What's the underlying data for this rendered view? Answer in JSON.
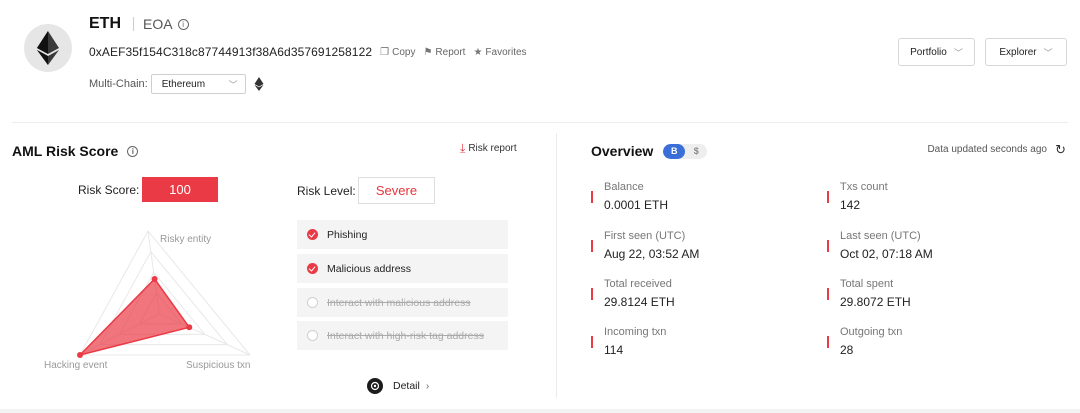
{
  "header": {
    "title": "ETH",
    "account_type": "EOA",
    "address": "0xAEF35f154C318c87744913f38A6d357691258122",
    "actions": {
      "copy": "Copy",
      "report": "Report",
      "favorites": "Favorites"
    },
    "multichain_label": "Multi-Chain:",
    "multichain_value": "Ethereum",
    "portfolio_label": "Portfolio",
    "explorer_label": "Explorer"
  },
  "aml": {
    "title": "AML Risk Score",
    "risk_report_label": "Risk report",
    "score_label": "Risk Score:",
    "score_value": "100",
    "level_label": "Risk Level:",
    "level_value": "Severe",
    "radar": {
      "axes": [
        "Risky entity",
        "Suspicious txn",
        "Hacking event"
      ],
      "values": [
        0.42,
        0.33,
        1.0
      ],
      "fill_color": "#ea3a46"
    },
    "risk_items": [
      {
        "label": "Phishing",
        "active": true
      },
      {
        "label": "Malicious address",
        "active": true
      },
      {
        "label": "Interact with malicious address",
        "active": false
      },
      {
        "label": "Interact with high-risk tag address",
        "active": false
      }
    ],
    "detail_label": "Detail"
  },
  "overview": {
    "title": "Overview",
    "toggle": [
      "B",
      "$"
    ],
    "updated_text": "Data updated seconds ago",
    "stats": [
      {
        "label": "Balance",
        "value": "0.0001 ETH"
      },
      {
        "label": "Txs count",
        "value": "142"
      },
      {
        "label": "First seen (UTC)",
        "value": "Aug 22, 03:52 AM"
      },
      {
        "label": "Last seen (UTC)",
        "value": "Oct 02, 07:18 AM"
      },
      {
        "label": "Total received",
        "value": "29.8124 ETH"
      },
      {
        "label": "Total spent",
        "value": "29.8072 ETH"
      },
      {
        "label": "Incoming txn",
        "value": "114"
      },
      {
        "label": "Outgoing txn",
        "value": "28"
      }
    ]
  },
  "colors": {
    "accent_red": "#ea3a46",
    "toggle_blue": "#3a6fd8"
  }
}
